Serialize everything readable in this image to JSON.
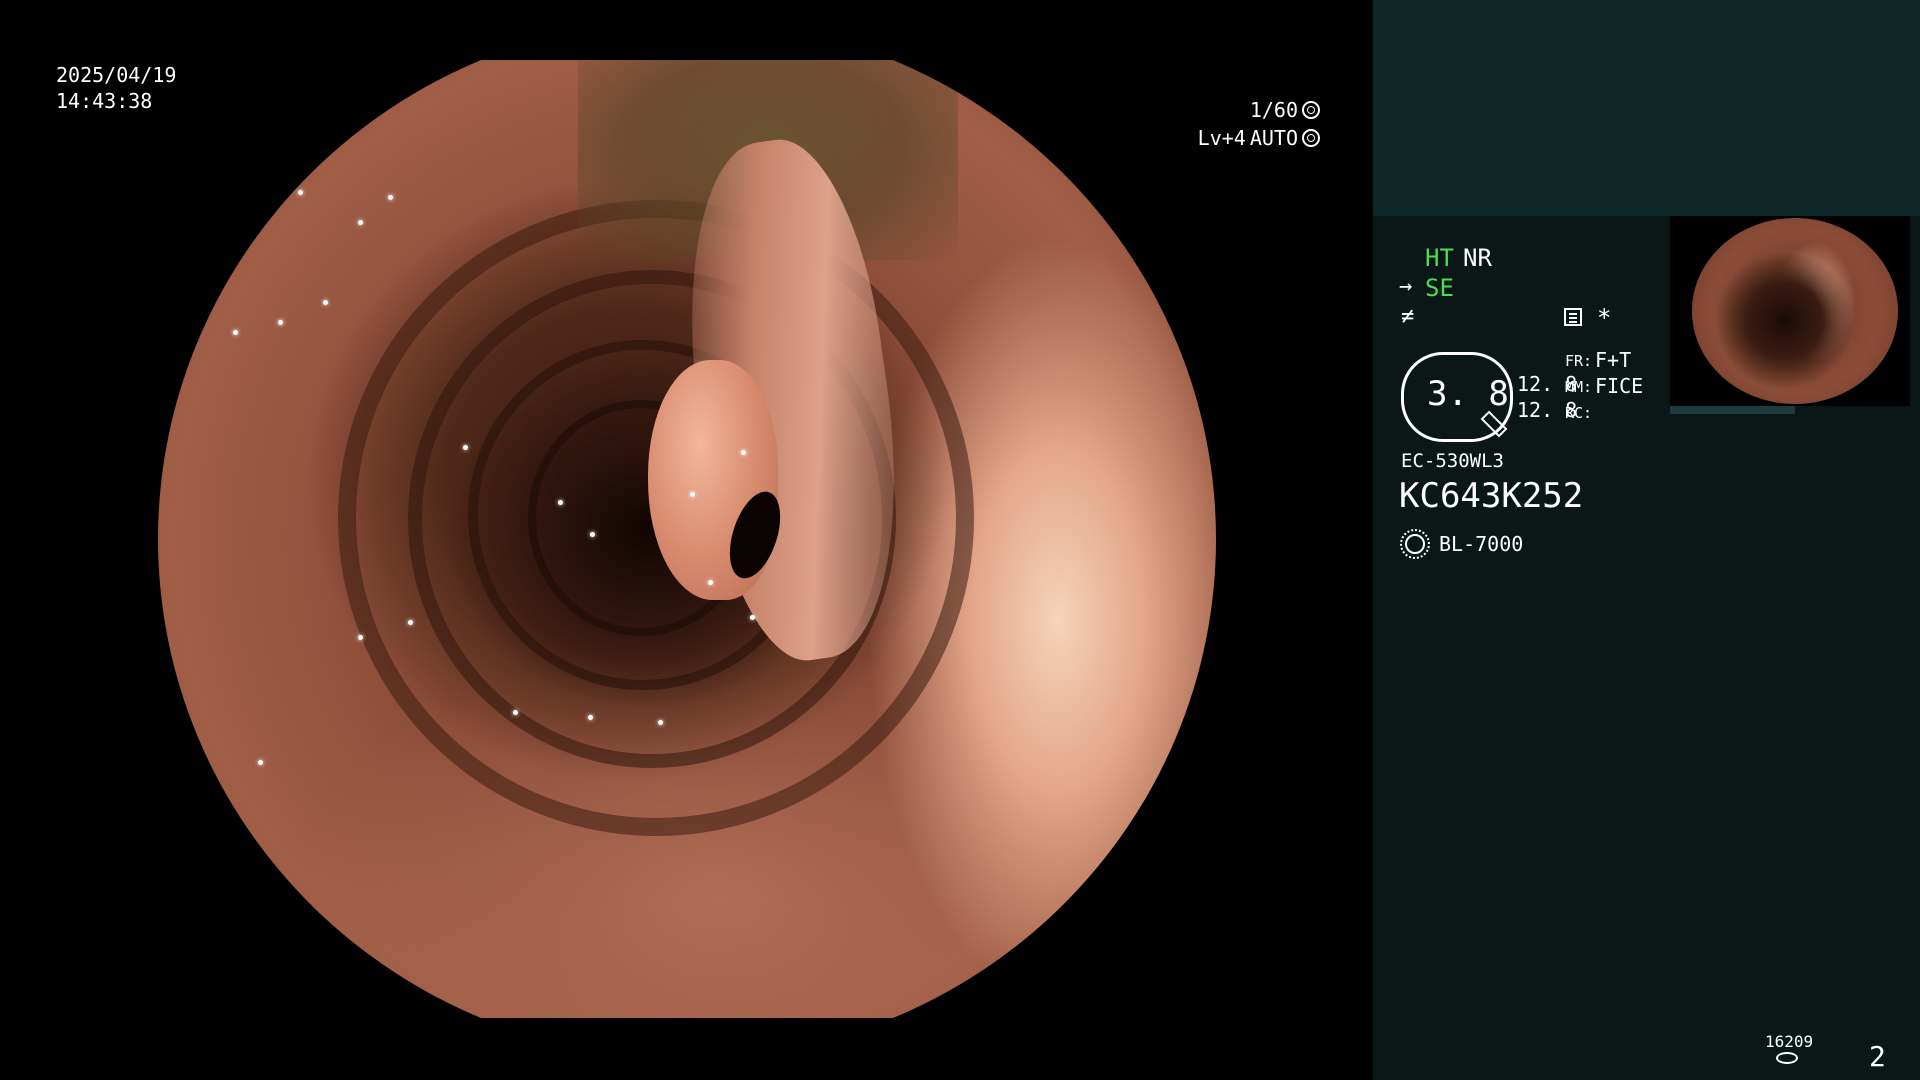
{
  "view": {
    "date": "2025/04/19",
    "time": "14:43:38",
    "shutter": "1/60",
    "iris_level": "Lv+4",
    "iris_mode": "AUTO"
  },
  "panel": {
    "ht_label": "HT",
    "nr_label": "NR",
    "se_label": "SE",
    "se_icon": "→",
    "fx_icon": "≠",
    "asterisk": "*",
    "zoom_value": "3. 8",
    "mm_value_1": "12. 8",
    "mm_value_2": "12. 8",
    "fr_label": "FR:",
    "fr_value": "F+T",
    "mm_label": "MM:",
    "mm_value": "FICE",
    "rc_label": "RC:",
    "scope_model": "EC-530WL3",
    "scope_serial": "KC643K252",
    "light_source": "BL-7000",
    "counter": "16209",
    "page_number": "2"
  },
  "colors": {
    "panel_bg": "#0b1717",
    "panel_top_bg": "#0f2727",
    "active_green": "#4cdc52"
  }
}
